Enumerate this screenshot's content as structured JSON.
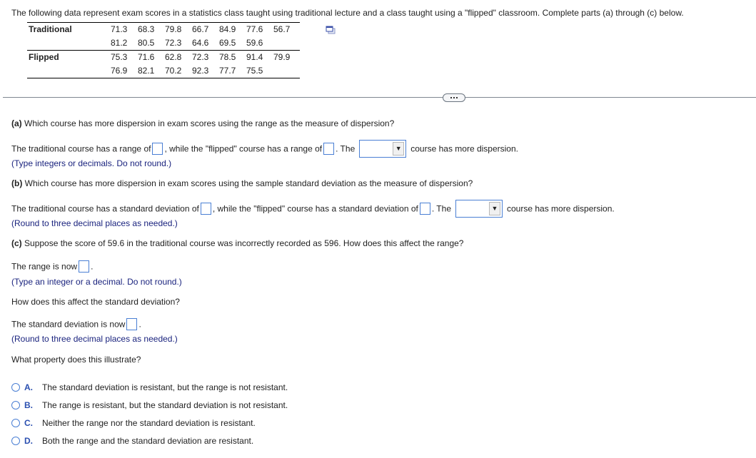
{
  "intro": "The following data represent exam scores in a statistics class taught using traditional lecture and a class taught using a \"flipped\" classroom. Complete parts (a) through (c) below.",
  "table": {
    "rows": [
      {
        "label": "Traditional",
        "values": [
          "71.3",
          "68.3",
          "79.8",
          "66.7",
          "84.9",
          "77.6",
          "56.7"
        ]
      },
      {
        "label": "",
        "values": [
          "81.2",
          "80.5",
          "72.3",
          "64.6",
          "69.5",
          "59.6",
          ""
        ]
      },
      {
        "label": "Flipped",
        "values": [
          "75.3",
          "71.6",
          "62.8",
          "72.3",
          "78.5",
          "91.4",
          "79.9"
        ]
      },
      {
        "label": "",
        "values": [
          "76.9",
          "82.1",
          "70.2",
          "92.3",
          "77.7",
          "75.5",
          ""
        ]
      }
    ],
    "copy_icon": "copy-data-icon"
  },
  "more_button_icon": "ellipsis-icon",
  "part_a": {
    "label": "(a)",
    "question": "Which course has more dispersion in exam scores using the range as the measure of dispersion?",
    "s1": "The traditional course has a range of",
    "s2": ", while the \"flipped\" course has a range of",
    "s3": ". The",
    "s4": "course has more dispersion.",
    "traditional_value": "",
    "flipped_value": "",
    "dropdown_value": "",
    "hint": "(Type integers or decimals. Do not round.)"
  },
  "part_b": {
    "label": "(b)",
    "question": "Which course has more dispersion in exam scores using the sample standard deviation as the measure of dispersion?",
    "s1": "The traditional course has a standard deviation of",
    "s2": ", while the \"flipped\" course has a standard deviation of",
    "s3": ". The",
    "s4": "course has more dispersion.",
    "traditional_value": "",
    "flipped_value": "",
    "dropdown_value": "",
    "hint": "(Round to three decimal places as needed.)"
  },
  "part_c": {
    "label": "(c)",
    "question": "Suppose the score of 59.6 in the traditional course was incorrectly recorded as 596. How does this affect the range?",
    "range_prefix": "The range is now",
    "range_value": "",
    "range_hint": "(Type an integer or a decimal. Do not round.)",
    "sd_question": "How does this affect the standard deviation?",
    "sd_prefix": "The standard deviation is now",
    "sd_value": "",
    "sd_hint": "(Round to three decimal places as needed.)",
    "property_question": "What property does this illustrate?",
    "options": [
      {
        "letter": "A.",
        "text": "The standard deviation is resistant, but the range is not resistant."
      },
      {
        "letter": "B.",
        "text": "The range is resistant, but the standard deviation is not resistant."
      },
      {
        "letter": "C.",
        "text": "Neither the range nor the standard deviation is resistant."
      },
      {
        "letter": "D.",
        "text": "Both the range and the standard deviation are resistant."
      }
    ]
  },
  "colors": {
    "hint": "#1a237e",
    "input_border": "#4a7fd4",
    "option_letter": "#2a4fb0"
  }
}
